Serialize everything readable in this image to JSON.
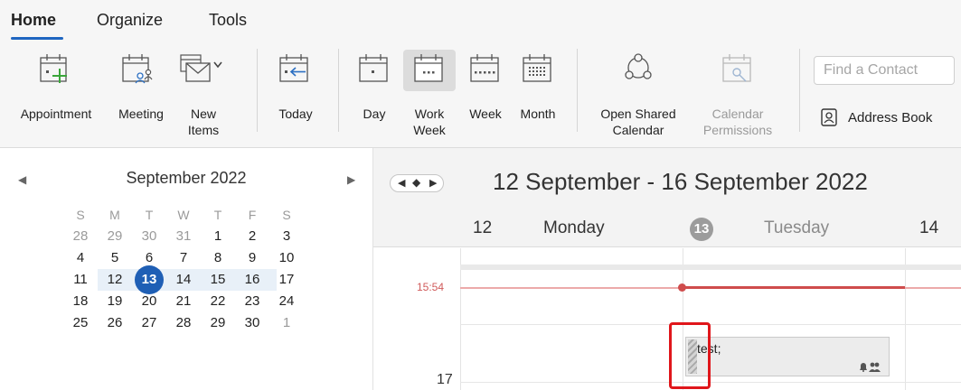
{
  "tabs": [
    {
      "label": "Home",
      "active": true
    },
    {
      "label": "Organize",
      "active": false
    },
    {
      "label": "Tools",
      "active": false
    }
  ],
  "ribbon": {
    "appointment": "Appointment",
    "meeting": "Meeting",
    "new_items_line1": "New",
    "new_items_line2": "Items",
    "today": "Today",
    "day": "Day",
    "work_week_line1": "Work",
    "work_week_line2": "Week",
    "week": "Week",
    "month": "Month",
    "open_shared_line1": "Open Shared",
    "open_shared_line2": "Calendar",
    "cal_perm_line1": "Calendar",
    "cal_perm_line2": "Permissions",
    "find_contact_placeholder": "Find a Contact",
    "address_book": "Address Book",
    "selected_view": "Work Week"
  },
  "mini_calendar": {
    "title": "September 2022",
    "weekday_headers": [
      "S",
      "M",
      "T",
      "W",
      "T",
      "F",
      "S"
    ],
    "weeks": [
      [
        "28",
        "29",
        "30",
        "31",
        "1",
        "2",
        "3"
      ],
      [
        "4",
        "5",
        "6",
        "7",
        "8",
        "9",
        "10"
      ],
      [
        "11",
        "12",
        "13",
        "14",
        "15",
        "16",
        "17"
      ],
      [
        "18",
        "19",
        "20",
        "21",
        "22",
        "23",
        "24"
      ],
      [
        "25",
        "26",
        "27",
        "28",
        "29",
        "30",
        "1"
      ]
    ],
    "today": "13",
    "selected_week_index": 2
  },
  "calendar": {
    "range_title": "12 September - 16 September 2022",
    "days": [
      {
        "num": "12",
        "name": "Monday"
      },
      {
        "num": "13",
        "name": "Tuesday"
      },
      {
        "num": "14",
        "name": ""
      }
    ],
    "current_time": "15:54",
    "hour_label": "17",
    "event": {
      "title": "test;",
      "status": "tentative"
    }
  },
  "colors": {
    "accent": "#1f5fb5",
    "now_line": "#cf4c4c",
    "highlight_box": "#e0161b"
  }
}
